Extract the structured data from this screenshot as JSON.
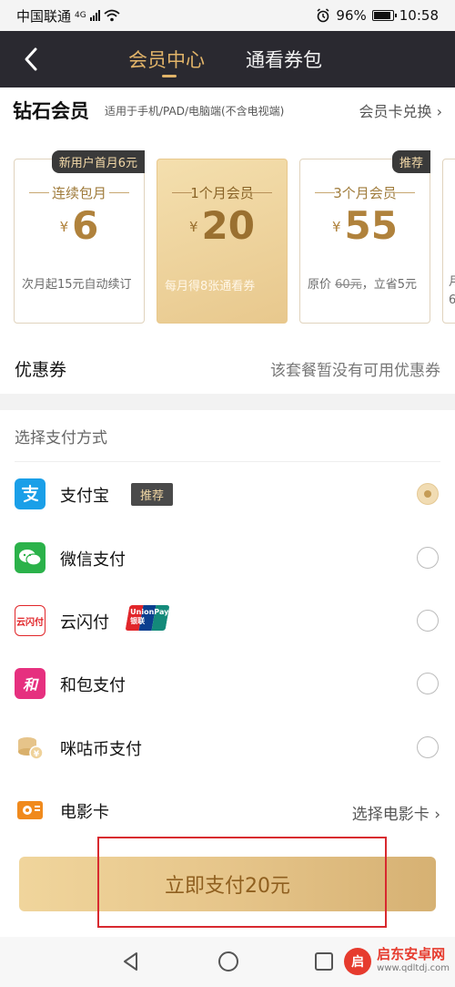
{
  "status_bar": {
    "carrier": "中国联通",
    "network": "4G",
    "battery": "96%",
    "time": "10:58",
    "battery_level": 0.96
  },
  "header": {
    "tab_active": "会员中心",
    "tab_inactive": "通看券包"
  },
  "member": {
    "title": "钻石会员",
    "desc": "适用于手机/PAD/电脑端(不含电视端)",
    "redeem": "会员卡兑换"
  },
  "plans": [
    {
      "badge": "新用户首月6元",
      "name": "连续包月",
      "currency": "¥",
      "price": "6",
      "desc": "次月起15元自动续订",
      "selected": false
    },
    {
      "badge": "",
      "name": "1个月会员",
      "currency": "¥",
      "price": "20",
      "desc": "每月得8张通看券",
      "selected": true
    },
    {
      "badge": "推荐",
      "name": "3个月会员",
      "currency": "¥",
      "price": "55",
      "desc_prefix": "原价 ",
      "desc_strike": "60元",
      "desc_suffix": "，立省5元",
      "selected": false
    },
    {
      "partial_top": "月",
      "partial_bottom": "6"
    }
  ],
  "coupon": {
    "label": "优惠券",
    "value": "该套餐暂没有可用优惠券"
  },
  "payment": {
    "heading": "选择支付方式",
    "methods": [
      {
        "label": "支付宝",
        "tag": "推荐",
        "icon": "alipay-icon",
        "color": "#1a9fe8",
        "selected": true
      },
      {
        "label": "微信支付",
        "icon": "wechat-pay-icon",
        "color": "#2bb24a",
        "selected": false
      },
      {
        "label": "云闪付",
        "icon": "cloud-quickpass-icon",
        "color": "#e1262a",
        "badge_text": "UnionPay 银联",
        "selected": false
      },
      {
        "label": "和包支付",
        "icon": "hebao-icon",
        "color": "#e6307f",
        "selected": false
      },
      {
        "label": "咪咕币支付",
        "icon": "migu-coin-icon",
        "color": "#e6c48a",
        "selected": false
      },
      {
        "label": "电影卡",
        "icon": "movie-card-icon",
        "color": "#f08a1d",
        "action": "选择电影卡"
      }
    ]
  },
  "pay_button": {
    "label": "立即支付20元"
  },
  "watermark": {
    "logo": "启",
    "line1": "启东安卓网",
    "line2": "www.qdltdj.com"
  }
}
